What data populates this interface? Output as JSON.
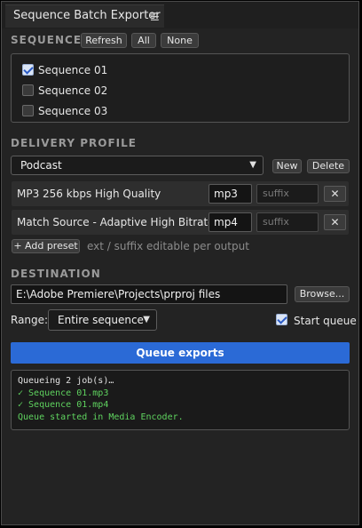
{
  "window": {
    "title": "Sequence Batch Exporter",
    "menu_icon": "hamburger-menu-icon"
  },
  "sequences": {
    "heading": "SEQUENCES",
    "refresh_label": "Refresh",
    "all_label": "All",
    "none_label": "None",
    "items": [
      {
        "label": "Sequence 01",
        "checked": true
      },
      {
        "label": "Sequence 02",
        "checked": false
      },
      {
        "label": "Sequence 03",
        "checked": false
      }
    ]
  },
  "delivery": {
    "heading": "DELIVERY PROFILE",
    "profile": "Podcast",
    "new_label": "New",
    "delete_label": "Delete",
    "presets": [
      {
        "name": "MP3 256 kbps High Quality",
        "ext": "mp3",
        "suffix_placeholder": "suffix",
        "remove_label": "✕"
      },
      {
        "name": "Match Source - Adaptive High Bitrate",
        "ext": "mp4",
        "suffix_placeholder": "suffix",
        "remove_label": "✕"
      }
    ],
    "add_preset_label": "+ Add preset",
    "hint": "ext / suffix editable per output"
  },
  "destination": {
    "heading": "DESTINATION",
    "path": "E:\\Adobe Premiere\\Projects\\prproj files",
    "browse_label": "Browse...",
    "range_label": "Range:",
    "range_value": "Entire sequence",
    "start_queue_label": "Start queue",
    "start_queue_checked": true
  },
  "queue_button_label": "Queue exports",
  "log": {
    "lines": [
      {
        "text": "Queueing 2 job(s)…",
        "color": "#e0e0e0"
      },
      {
        "text": "✓ Sequence 01.mp3",
        "color": "#5fd35f"
      },
      {
        "text": "✓ Sequence 01.mp4",
        "color": "#5fd35f"
      },
      {
        "text": "Queue started in Media Encoder.",
        "color": "#5fd35f"
      }
    ]
  },
  "colors": {
    "accent": "#2b6ad6",
    "success": "#5fd35f",
    "background": "#232323"
  }
}
